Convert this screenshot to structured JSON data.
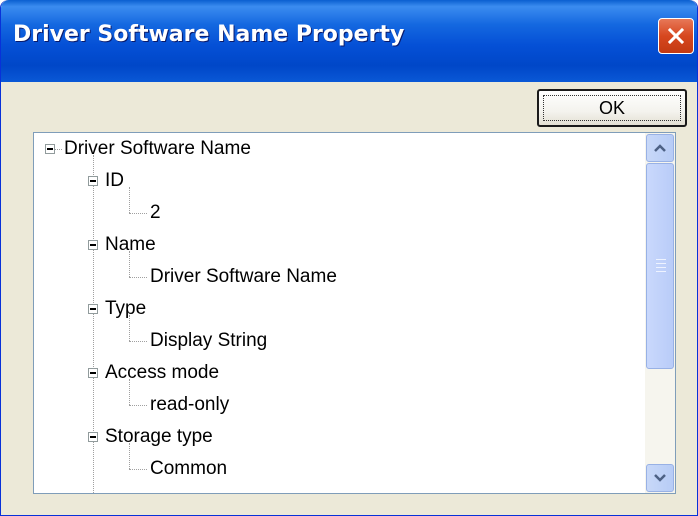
{
  "window": {
    "title": "Driver Software Name Property",
    "close_icon": "close-icon",
    "ok_label": "OK"
  },
  "colors": {
    "titlebar": "#0550D6",
    "dialog_bg": "#ECE9D8",
    "close_button": "#D7471F",
    "scroll_accent": "#B9CCF8"
  },
  "tree": {
    "root": {
      "label": "Driver Software Name",
      "expanded": true
    },
    "items": [
      {
        "label": "ID",
        "expanded": true,
        "value": "2"
      },
      {
        "label": "Name",
        "expanded": true,
        "value": "Driver Software Name"
      },
      {
        "label": "Type",
        "expanded": true,
        "value": "Display String"
      },
      {
        "label": "Access mode",
        "expanded": true,
        "value": "read-only"
      },
      {
        "label": "Storage type",
        "expanded": true,
        "value": "Common"
      }
    ]
  },
  "scrollbar": {
    "up_icon": "scroll-up-arrow-icon",
    "down_icon": "scroll-down-arrow-icon",
    "thumb_icon": "scroll-thumb-grip-icon"
  }
}
